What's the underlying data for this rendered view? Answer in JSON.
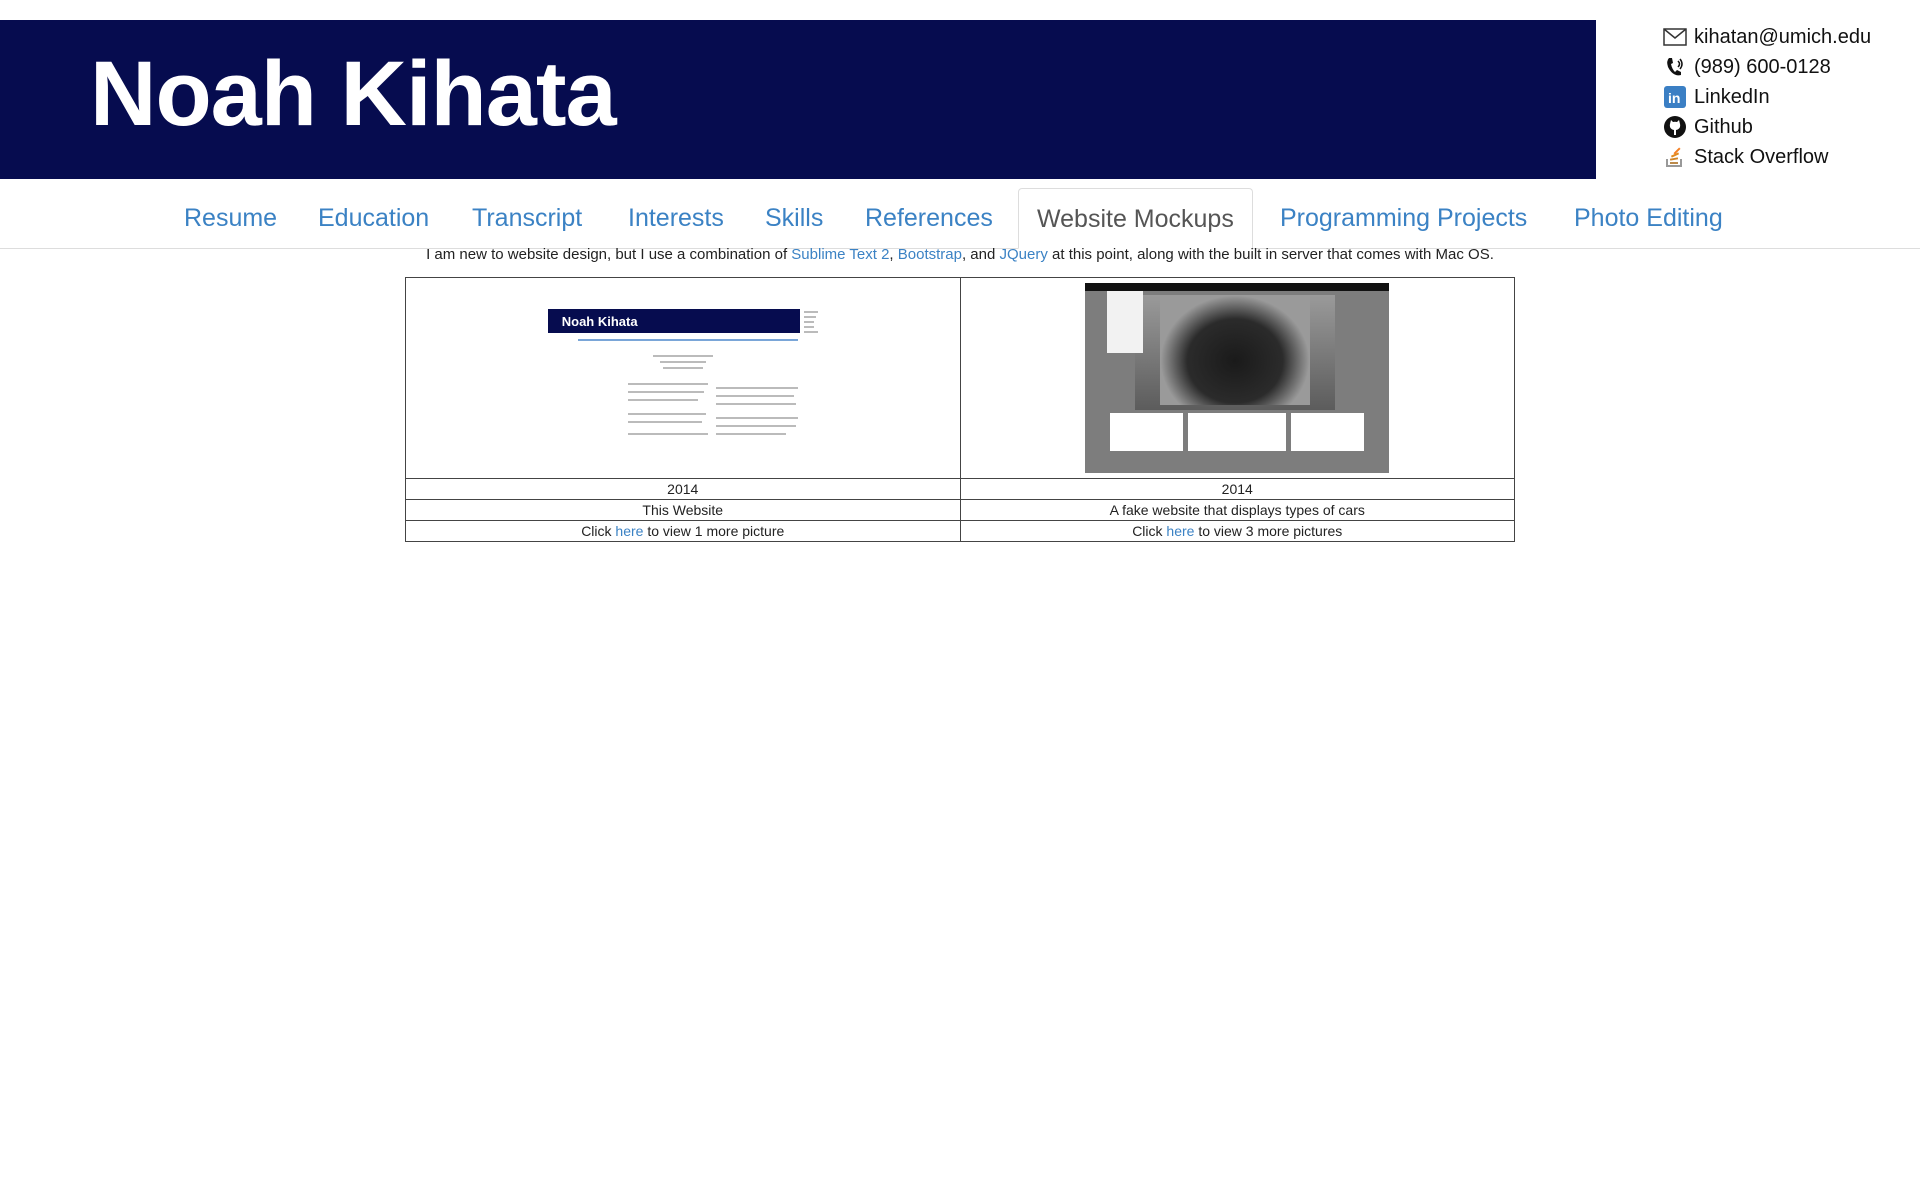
{
  "header": {
    "name": "Noah Kihata"
  },
  "contact": [
    {
      "icon": "mail-icon",
      "label": "kihatan@umich.edu"
    },
    {
      "icon": "phone-icon",
      "label": "(989) 600-0128"
    },
    {
      "icon": "linkedin-icon",
      "label": "LinkedIn"
    },
    {
      "icon": "github-icon",
      "label": "Github"
    },
    {
      "icon": "stackoverflow-icon",
      "label": "Stack Overflow"
    }
  ],
  "tabs": [
    {
      "label": "Resume"
    },
    {
      "label": "Education"
    },
    {
      "label": "Transcript"
    },
    {
      "label": "Interests"
    },
    {
      "label": "Skills"
    },
    {
      "label": "References"
    },
    {
      "label": "Website Mockups",
      "active": true
    },
    {
      "label": "Programming Projects"
    },
    {
      "label": "Photo Editing"
    }
  ],
  "intro": {
    "before": "I am new to website design, but I use a combination of ",
    "link1": "Sublime Text 2",
    "sep1": ", ",
    "link2": "Bootstrap",
    "sep2": ", and ",
    "link3": "JQuery",
    "after": " at this point, along with the built in server that comes with Mac OS."
  },
  "mockups": [
    {
      "year": "2014",
      "title": "This Website",
      "click_prefix": "Click ",
      "link": "here",
      "click_suffix": " to view 1 more picture",
      "thumb_title": "Noah Kihata"
    },
    {
      "year": "2014",
      "title": "A fake website that displays types of cars",
      "click_prefix": "Click ",
      "link": "here",
      "click_suffix": " to view 3 more pictures"
    }
  ],
  "colors": {
    "banner": "#060c4f",
    "link": "#3b82c4",
    "active_tab_text": "#555555"
  }
}
